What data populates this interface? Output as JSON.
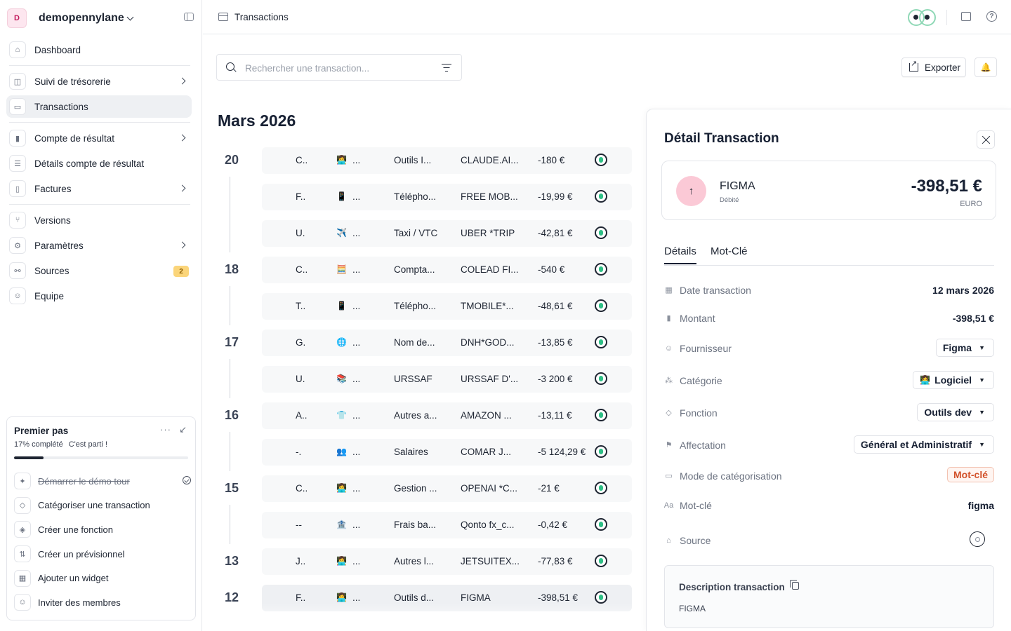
{
  "org": {
    "initial": "D",
    "name": "demopennylane"
  },
  "nav": [
    {
      "label": "Dashboard",
      "icon": "home-icon",
      "glyph": "⌂",
      "chevron": false,
      "badge": "",
      "active": false
    },
    {
      "sep": true
    },
    {
      "label": "Suivi de trésorerie",
      "icon": "chart-icon",
      "glyph": "◫",
      "chevron": true,
      "badge": "",
      "active": false
    },
    {
      "label": "Transactions",
      "icon": "card-icon",
      "glyph": "▭",
      "chevron": false,
      "badge": "",
      "active": true
    },
    {
      "sep": true
    },
    {
      "label": "Compte de résultat",
      "icon": "bar-chart-icon",
      "glyph": "▮",
      "chevron": true,
      "badge": "",
      "active": false
    },
    {
      "label": "Détails compte de résultat",
      "icon": "list-icon",
      "glyph": "☰",
      "chevron": false,
      "badge": "",
      "active": false
    },
    {
      "label": "Factures",
      "icon": "document-icon",
      "glyph": "▯",
      "chevron": true,
      "badge": "",
      "active": false
    },
    {
      "sep": true
    },
    {
      "label": "Versions",
      "icon": "branch-icon",
      "glyph": "⑂",
      "chevron": false,
      "badge": "",
      "active": false
    },
    {
      "label": "Paramètres",
      "icon": "gear-icon",
      "glyph": "⚙",
      "chevron": true,
      "badge": "",
      "active": false
    },
    {
      "label": "Sources",
      "icon": "plug-icon",
      "glyph": "⚯",
      "chevron": false,
      "badge": "2",
      "active": false
    },
    {
      "label": "Equipe",
      "icon": "users-icon",
      "glyph": "☺",
      "chevron": false,
      "badge": "",
      "active": false
    }
  ],
  "onboarding": {
    "title": "Premier pas",
    "progress_text": "17% complété",
    "progress_sub": "C'est parti !",
    "progress": 0.17,
    "items": [
      {
        "label": "Démarrer le démo tour",
        "icon": "gift-icon",
        "glyph": "✦",
        "done": true
      },
      {
        "label": "Catégoriser une transaction",
        "icon": "tag-icon",
        "glyph": "◇",
        "done": false
      },
      {
        "label": "Créer une fonction",
        "icon": "tags-icon",
        "glyph": "◈",
        "done": false
      },
      {
        "label": "Créer un prévisionnel",
        "icon": "forecast-icon",
        "glyph": "⇅",
        "done": false
      },
      {
        "label": "Ajouter un widget",
        "icon": "widget-icon",
        "glyph": "▦",
        "done": false
      },
      {
        "label": "Inviter des membres",
        "icon": "users-icon",
        "glyph": "☺",
        "done": false
      }
    ]
  },
  "topbar": {
    "title": "Transactions"
  },
  "search": {
    "placeholder": "Rechercher une transaction..."
  },
  "actions": {
    "export_label": "Exporter"
  },
  "month": "Mars 2026",
  "days": [
    {
      "day": "20",
      "rows": [
        {
          "a": "C..",
          "emoji": "👩‍💻",
          "category": "Outils I...",
          "label": "CLAUDE.AI...",
          "amount": "-180 €"
        },
        {
          "a": "F..",
          "emoji": "📱",
          "category": "Télépho...",
          "label": "FREE MOB...",
          "amount": "-19,99 €"
        },
        {
          "a": "U.",
          "emoji": "✈️",
          "category": "Taxi / VTC",
          "label": "UBER *TRIP",
          "amount": "-42,81 €"
        }
      ]
    },
    {
      "day": "18",
      "rows": [
        {
          "a": "C..",
          "emoji": "🧮",
          "category": "Compta...",
          "label": "COLEAD FI...",
          "amount": "-540 €"
        },
        {
          "a": "T..",
          "emoji": "📱",
          "category": "Télépho...",
          "label": "TMOBILE*...",
          "amount": "-48,61 €"
        }
      ]
    },
    {
      "day": "17",
      "rows": [
        {
          "a": "G.",
          "emoji": "🌐",
          "category": "Nom de...",
          "label": "DNH*GOD...",
          "amount": "-13,85 €"
        },
        {
          "a": "U.",
          "emoji": "📚",
          "category": "URSSAF",
          "label": "URSSAF D'...",
          "amount": "-3 200 €"
        }
      ]
    },
    {
      "day": "16",
      "rows": [
        {
          "a": "A..",
          "emoji": "👕",
          "category": "Autres a...",
          "label": "AMAZON ...",
          "amount": "-13,11 €"
        },
        {
          "a": "-.",
          "emoji": "👥",
          "category": "Salaires",
          "label": "COMAR J...",
          "amount": "-5 124,29 €"
        }
      ]
    },
    {
      "day": "15",
      "rows": [
        {
          "a": "C..",
          "emoji": "👩‍💻",
          "category": "Gestion ...",
          "label": "OPENAI *C...",
          "amount": "-21 €"
        },
        {
          "a": "--",
          "emoji": "🏦",
          "category": "Frais ba...",
          "label": "Qonto fx_c...",
          "amount": "-0,42 €"
        }
      ]
    },
    {
      "day": "13",
      "rows": [
        {
          "a": "J..",
          "emoji": "👩‍💻",
          "category": "Autres l...",
          "label": "JETSUITEX...",
          "amount": "-77,83 €"
        }
      ]
    },
    {
      "day": "12",
      "rows": [
        {
          "a": "F..",
          "emoji": "👩‍💻",
          "category": "Outils d...",
          "label": "FIGMA",
          "amount": "-398,51 €",
          "selected": true
        }
      ]
    }
  ],
  "detail": {
    "title": "Détail Transaction",
    "vendor": "FIGMA",
    "direction": "Débité",
    "amount": "-398,51 €",
    "currency": "EURO",
    "tabs": [
      "Détails",
      "Mot-Clé"
    ],
    "fields": [
      {
        "label": "Date transaction",
        "icon": "calendar-icon",
        "glyph": "▦",
        "kind": "text",
        "value": "12 mars 2026"
      },
      {
        "label": "Montant",
        "icon": "bar-chart-icon",
        "glyph": "▮",
        "kind": "text",
        "value": "-398,51 €"
      },
      {
        "label": "Fournisseur",
        "icon": "user-icon",
        "glyph": "☺",
        "kind": "select",
        "value": "Figma"
      },
      {
        "label": "Catégorie",
        "icon": "shapes-icon",
        "glyph": "⁂",
        "kind": "select",
        "value": "Logiciel",
        "emoji": "👩‍💻"
      },
      {
        "label": "Fonction",
        "icon": "tag-icon",
        "glyph": "◇",
        "kind": "select",
        "value": "Outils dev"
      },
      {
        "label": "Affectation",
        "icon": "flag-icon",
        "glyph": "⚑",
        "kind": "select",
        "value": "Général et Administratif"
      },
      {
        "label": "Mode de catégorisation",
        "icon": "folder-icon",
        "glyph": "▭",
        "kind": "tag",
        "value": "Mot-clé"
      },
      {
        "label": "Mot-clé",
        "icon": "text-icon",
        "glyph": "Aa",
        "kind": "text",
        "value": "figma"
      },
      {
        "label": "Source",
        "icon": "bank-icon",
        "glyph": "⌂",
        "kind": "source",
        "value": ""
      }
    ],
    "description_title": "Description transaction",
    "description_text": "FIGMA"
  }
}
